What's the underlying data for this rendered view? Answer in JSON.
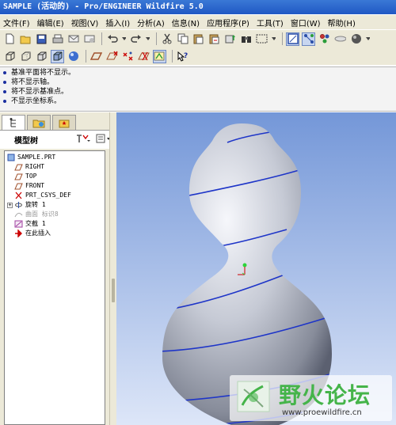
{
  "window": {
    "title": "SAMPLE (活动的) - Pro/ENGINEER Wildfire 5.0"
  },
  "menubar": {
    "items": [
      {
        "label": "文件(F)"
      },
      {
        "label": "编辑(E)"
      },
      {
        "label": "视图(V)"
      },
      {
        "label": "插入(I)"
      },
      {
        "label": "分析(A)"
      },
      {
        "label": "信息(N)"
      },
      {
        "label": "应用程序(P)"
      },
      {
        "label": "工具(T)"
      },
      {
        "label": "窗口(W)"
      },
      {
        "label": "帮助(H)"
      }
    ]
  },
  "toolbar1": {
    "icons": [
      "new-file-icon",
      "open-folder-icon",
      "save-icon",
      "print-icon",
      "email-icon",
      "email-attach-icon",
      "undo-icon",
      "undo-dropdown-icon",
      "redo-icon",
      "redo-dropdown-icon",
      "cut-icon",
      "copy-icon",
      "paste-icon",
      "paste-special-icon",
      "regenerate-icon",
      "find-icon",
      "selection-box-icon",
      "window-icon",
      "datum-axis-icon",
      "datum-point-icon",
      "sphere-icon"
    ]
  },
  "toolbar2": {
    "icons": [
      "no-hidden-icon",
      "hidden-line-icon",
      "wireframe-icon",
      "shaded-icon",
      "enhanced-realism-icon",
      "datum-plane-display-icon",
      "axis-display-icon",
      "point-display-icon",
      "csys-display-icon",
      "annotation-display-icon",
      "whats-this-icon"
    ]
  },
  "messages": [
    "基准平面将不显示。",
    "将不显示轴。",
    "将不显示基准点。",
    "不显示坐标系。"
  ],
  "left_panel": {
    "tabs": [
      "model-tree-tab-icon",
      "folder-browser-tab-icon",
      "favorites-tab-icon"
    ],
    "header": "模型树",
    "tree": [
      {
        "label": "SAMPLE.PRT",
        "icon": "part-icon"
      },
      {
        "label": "RIGHT",
        "icon": "datum-plane-icon"
      },
      {
        "label": "TOP",
        "icon": "datum-plane-icon"
      },
      {
        "label": "FRONT",
        "icon": "datum-plane-icon"
      },
      {
        "label": "PRT_CSYS_DEF",
        "icon": "csys-icon"
      },
      {
        "label": "旋转 1",
        "icon": "revolve-icon"
      },
      {
        "label": "曲面 标识8",
        "icon": "surface-icon"
      },
      {
        "label": "交截 1",
        "icon": "intersect-icon"
      },
      {
        "label": "在此插入",
        "icon": "insert-here-arrow-icon"
      }
    ]
  },
  "watermark": {
    "title": "野火论坛",
    "url": "www.proewildfire.cn"
  },
  "colors": {
    "title_bar": "#2058c4",
    "viewport_top": "#7497d8",
    "viewport_bottom": "#dde6f8",
    "helix_curve": "#1e35c8",
    "watermark_text": "#45b44a"
  }
}
